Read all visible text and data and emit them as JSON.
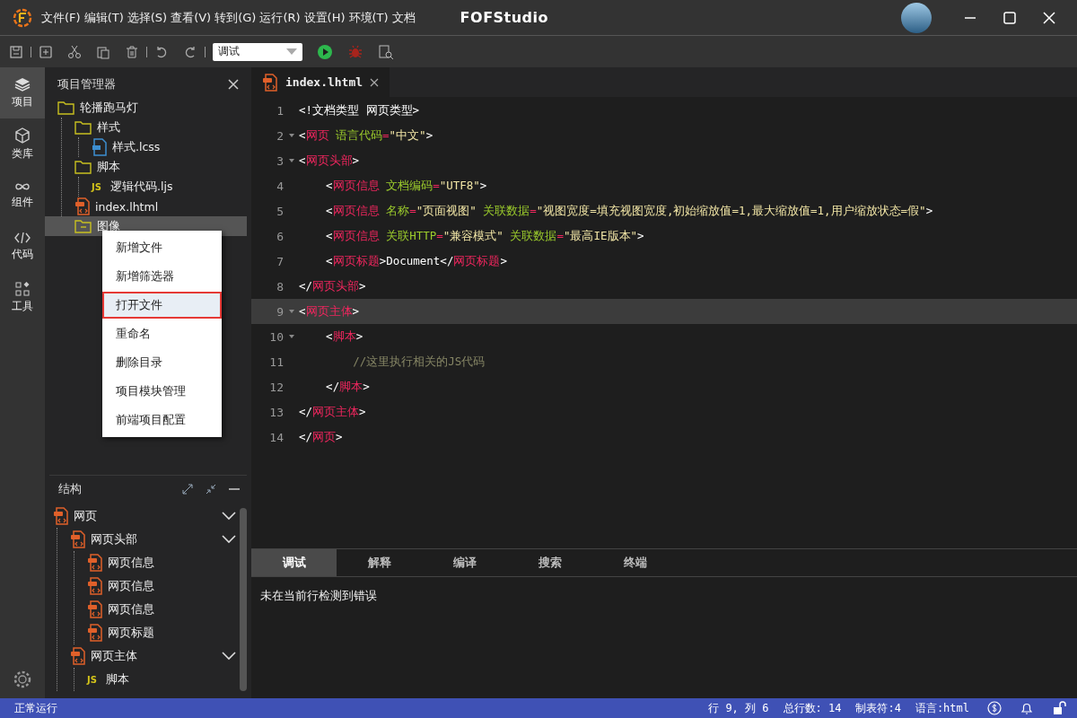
{
  "menu_bar": {
    "items": [
      "文件(F)",
      "编辑(T)",
      "选择(S)",
      "查看(V)",
      "转到(G)",
      "运行(R)",
      "设置(H)",
      "环境(T)",
      "文档"
    ]
  },
  "window": {
    "title": "FOFStudio"
  },
  "toolbar": {
    "mode_select": {
      "value": "调试"
    }
  },
  "activity_bar": {
    "items": [
      {
        "label": "项目",
        "kind": "layers",
        "selected": true
      },
      {
        "label": "类库",
        "kind": "cube",
        "selected": false
      },
      {
        "label": "组件",
        "kind": "link",
        "selected": false
      },
      {
        "label": "代码",
        "kind": "code",
        "selected": false
      },
      {
        "label": "工具",
        "kind": "tools",
        "selected": false
      }
    ]
  },
  "project_explorer": {
    "title": "项目管理器",
    "tree": [
      {
        "label": "轮播跑马灯",
        "kind": "folder",
        "expanded": true,
        "selected": false,
        "children": [
          {
            "label": "样式",
            "kind": "folder",
            "expanded": true,
            "selected": false,
            "children": [
              {
                "label": "样式.lcss",
                "kind": "css",
                "selected": false
              }
            ]
          },
          {
            "label": "脚本",
            "kind": "folder",
            "expanded": true,
            "selected": false,
            "children": [
              {
                "label": "逻辑代码.ljs",
                "kind": "js",
                "badge": "JS",
                "selected": false
              }
            ]
          },
          {
            "label": "index.lhtml",
            "kind": "html",
            "selected": false
          },
          {
            "label": "图像",
            "kind": "folder",
            "expanded": false,
            "selected": true
          }
        ]
      }
    ]
  },
  "context_menu": {
    "items": [
      {
        "label": "新增文件",
        "selected": false
      },
      {
        "label": "新增筛选器",
        "selected": false
      },
      {
        "label": "打开文件",
        "selected": true
      },
      {
        "label": "重命名",
        "selected": false
      },
      {
        "label": "删除目录",
        "selected": false
      },
      {
        "label": "项目模块管理",
        "selected": false
      },
      {
        "label": "前端项目配置",
        "selected": false
      }
    ]
  },
  "structure": {
    "title": "结构",
    "tree": [
      {
        "label": "网页",
        "kind": "html",
        "expanded": true,
        "children": [
          {
            "label": "网页头部",
            "kind": "html",
            "expanded": true,
            "children": [
              {
                "label": "网页信息",
                "kind": "html"
              },
              {
                "label": "网页信息",
                "kind": "html"
              },
              {
                "label": "网页信息",
                "kind": "html"
              },
              {
                "label": "网页标题",
                "kind": "html"
              }
            ]
          },
          {
            "label": "网页主体",
            "kind": "html",
            "expanded": true,
            "children": [
              {
                "label": "脚本",
                "kind": "js",
                "badge": "JS"
              }
            ]
          }
        ]
      }
    ]
  },
  "editor": {
    "tabs": [
      {
        "label": "index.lhtml",
        "selected": true
      }
    ],
    "lines": [
      {
        "number": "1",
        "foldable": false,
        "selected": false,
        "tokens": [
          {
            "kind": "punct",
            "text": "<!文档类型 网页类型>"
          }
        ]
      },
      {
        "number": "2",
        "foldable": true,
        "selected": false,
        "tokens": [
          {
            "kind": "punct",
            "text": "<"
          },
          {
            "kind": "tag",
            "text": "网页"
          },
          {
            "kind": "attr",
            "text": " 语言代码"
          },
          {
            "kind": "tag",
            "text": "="
          },
          {
            "kind": "string",
            "text": "\"中文\""
          },
          {
            "kind": "punct",
            "text": ">"
          }
        ]
      },
      {
        "number": "3",
        "foldable": true,
        "selected": false,
        "tokens": [
          {
            "kind": "punct",
            "text": "<"
          },
          {
            "kind": "tag",
            "text": "网页头部"
          },
          {
            "kind": "punct",
            "text": ">"
          }
        ]
      },
      {
        "number": "4",
        "foldable": false,
        "selected": false,
        "tokens": [
          {
            "kind": "punct",
            "text": "    <"
          },
          {
            "kind": "tag",
            "text": "网页信息"
          },
          {
            "kind": "attr",
            "text": " 文档编码"
          },
          {
            "kind": "tag",
            "text": "="
          },
          {
            "kind": "string",
            "text": "\"UTF8\""
          },
          {
            "kind": "punct",
            "text": ">"
          }
        ]
      },
      {
        "number": "5",
        "foldable": false,
        "selected": false,
        "tokens": [
          {
            "kind": "punct",
            "text": "    <"
          },
          {
            "kind": "tag",
            "text": "网页信息"
          },
          {
            "kind": "attr",
            "text": " 名称"
          },
          {
            "kind": "tag",
            "text": "="
          },
          {
            "kind": "string",
            "text": "\"页面视图\""
          },
          {
            "kind": "attr",
            "text": " 关联数据"
          },
          {
            "kind": "tag",
            "text": "="
          },
          {
            "kind": "string",
            "text": "\"视图宽度=填充视图宽度,初始缩放值=1,最大缩放值=1,用户缩放状态=假\""
          },
          {
            "kind": "punct",
            "text": ">"
          }
        ]
      },
      {
        "number": "6",
        "foldable": false,
        "selected": false,
        "tokens": [
          {
            "kind": "punct",
            "text": "    <"
          },
          {
            "kind": "tag",
            "text": "网页信息"
          },
          {
            "kind": "attr",
            "text": " 关联HTTP"
          },
          {
            "kind": "tag",
            "text": "="
          },
          {
            "kind": "string",
            "text": "\"兼容模式\""
          },
          {
            "kind": "attr",
            "text": " 关联数据"
          },
          {
            "kind": "tag",
            "text": "="
          },
          {
            "kind": "string",
            "text": "\"最高IE版本\""
          },
          {
            "kind": "punct",
            "text": ">"
          }
        ]
      },
      {
        "number": "7",
        "foldable": false,
        "selected": false,
        "tokens": [
          {
            "kind": "punct",
            "text": "    <"
          },
          {
            "kind": "tag",
            "text": "网页标题"
          },
          {
            "kind": "punct",
            "text": ">Document</"
          },
          {
            "kind": "tag",
            "text": "网页标题"
          },
          {
            "kind": "punct",
            "text": ">"
          }
        ]
      },
      {
        "number": "8",
        "foldable": false,
        "selected": false,
        "tokens": [
          {
            "kind": "punct",
            "text": "</"
          },
          {
            "kind": "tag",
            "text": "网页头部"
          },
          {
            "kind": "punct",
            "text": ">"
          }
        ]
      },
      {
        "number": "9",
        "foldable": true,
        "selected": true,
        "tokens": [
          {
            "kind": "punct",
            "text": "<"
          },
          {
            "kind": "tag",
            "text": "网页主体"
          },
          {
            "kind": "punct",
            "text": ">"
          }
        ]
      },
      {
        "number": "10",
        "foldable": true,
        "selected": false,
        "tokens": [
          {
            "kind": "punct",
            "text": "    <"
          },
          {
            "kind": "tag",
            "text": "脚本"
          },
          {
            "kind": "punct",
            "text": ">"
          }
        ]
      },
      {
        "number": "11",
        "foldable": false,
        "selected": false,
        "tokens": [
          {
            "kind": "comment",
            "text": "        //这里执行相关的JS代码"
          }
        ]
      },
      {
        "number": "12",
        "foldable": false,
        "selected": false,
        "tokens": [
          {
            "kind": "punct",
            "text": "    </"
          },
          {
            "kind": "tag",
            "text": "脚本"
          },
          {
            "kind": "punct",
            "text": ">"
          }
        ]
      },
      {
        "number": "13",
        "foldable": false,
        "selected": false,
        "tokens": [
          {
            "kind": "punct",
            "text": "</"
          },
          {
            "kind": "tag",
            "text": "网页主体"
          },
          {
            "kind": "punct",
            "text": ">"
          }
        ]
      },
      {
        "number": "14",
        "foldable": false,
        "selected": false,
        "tokens": [
          {
            "kind": "punct",
            "text": "</"
          },
          {
            "kind": "tag",
            "text": "网页"
          },
          {
            "kind": "punct",
            "text": ">"
          }
        ]
      }
    ]
  },
  "output_panel": {
    "tabs": [
      {
        "label": "调试",
        "selected": true
      },
      {
        "label": "解释",
        "selected": false
      },
      {
        "label": "编译",
        "selected": false
      },
      {
        "label": "搜索",
        "selected": false
      },
      {
        "label": "终端",
        "selected": false
      }
    ],
    "message": "未在当前行检测到错误"
  },
  "status_bar": {
    "state": "正常运行",
    "items": [
      "行 9, 列 6",
      "总行数: 14",
      "制表符:4",
      "语言:html"
    ]
  }
}
